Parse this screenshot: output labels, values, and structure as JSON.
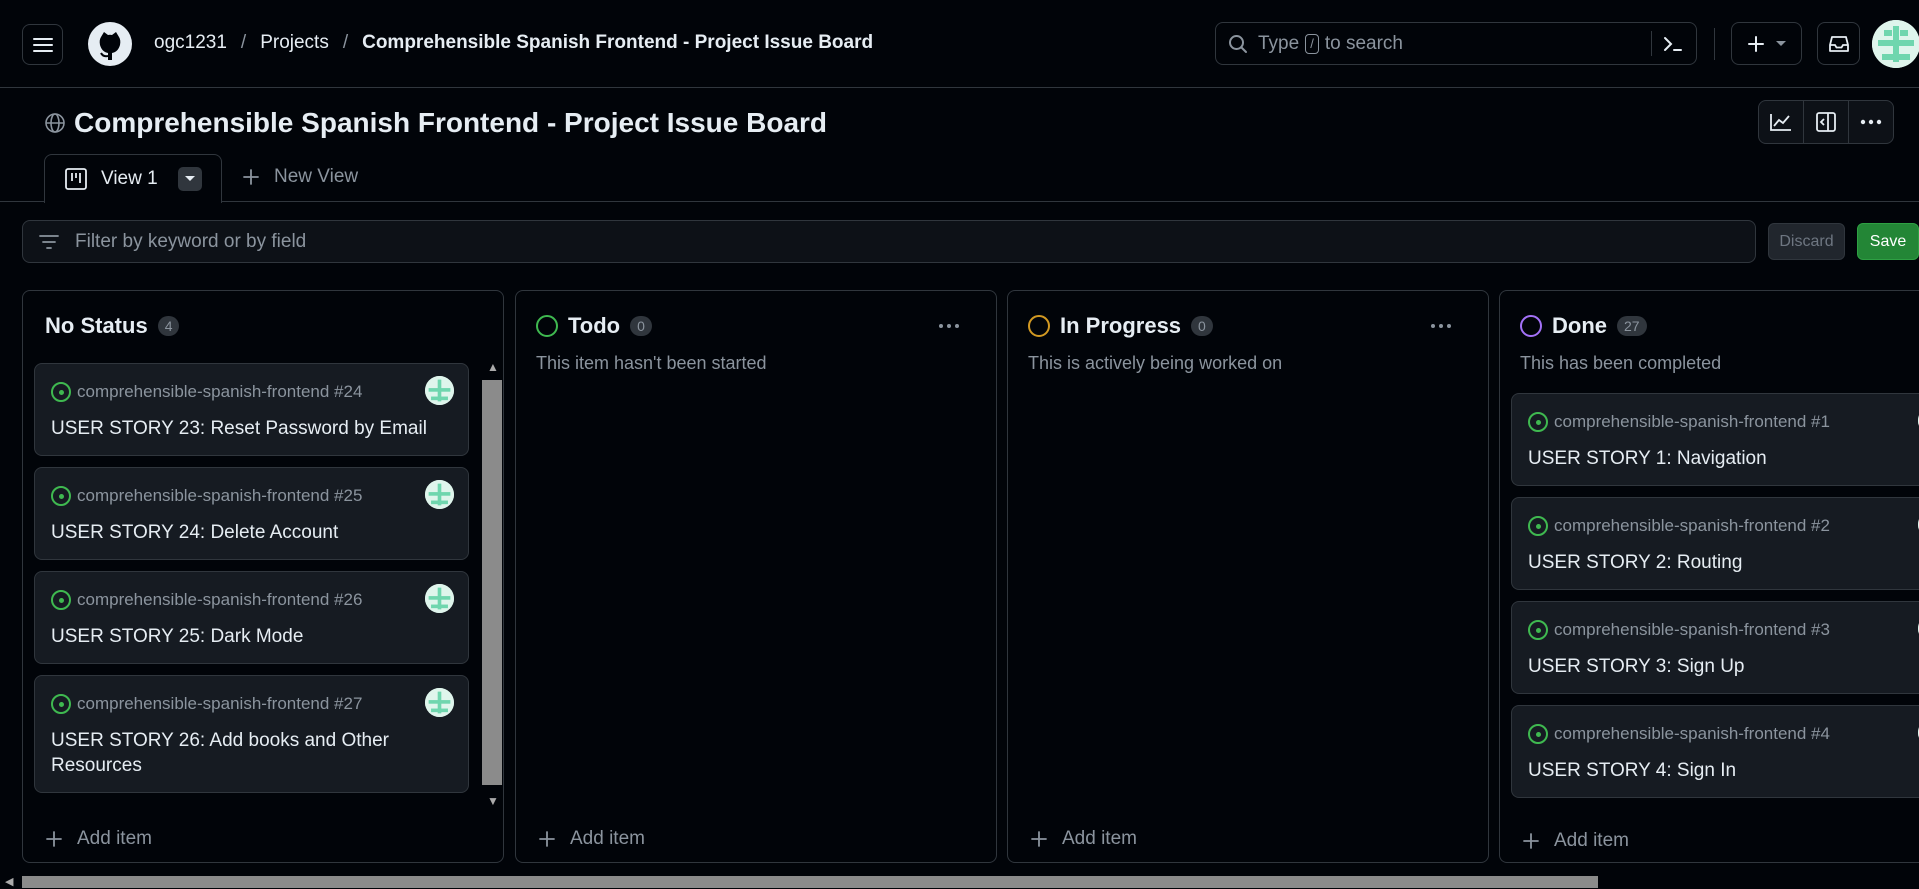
{
  "header": {
    "breadcrumbs": [
      "ogc1231",
      "Projects",
      "Comprehensible Spanish Frontend - Project Issue Board"
    ],
    "separator": "/",
    "search": {
      "prefix": "Type",
      "key": "/",
      "suffix": "to search"
    }
  },
  "project": {
    "title": "Comprehensible Spanish Frontend - Project Issue Board"
  },
  "tabs": {
    "active": "View 1",
    "new_view": "New View"
  },
  "filter": {
    "placeholder": "Filter by keyword or by field",
    "discard": "Discard",
    "save": "Save"
  },
  "colors": {
    "green": "#3fb950",
    "orange": "#d29922",
    "purple": "#a371f7",
    "save": "#238636"
  },
  "columns": [
    {
      "name": "No Status",
      "count": "4",
      "description": "",
      "add_item": "Add item",
      "cards": [
        {
          "repo": "comprehensible-spanish-frontend #24",
          "title": "USER STORY 23: Reset Password by Email"
        },
        {
          "repo": "comprehensible-spanish-frontend #25",
          "title": "USER STORY 24: Delete Account"
        },
        {
          "repo": "comprehensible-spanish-frontend #26",
          "title": "USER STORY 25: Dark Mode"
        },
        {
          "repo": "comprehensible-spanish-frontend #27",
          "title": "USER STORY 26: Add books and Other Resources"
        }
      ]
    },
    {
      "name": "Todo",
      "count": "0",
      "description": "This item hasn't been started",
      "add_item": "Add item",
      "cards": []
    },
    {
      "name": "In Progress",
      "count": "0",
      "description": "This is actively being worked on",
      "add_item": "Add item",
      "cards": []
    },
    {
      "name": "Done",
      "count": "27",
      "description": "This has been completed",
      "add_item": "Add item",
      "cards": [
        {
          "repo": "comprehensible-spanish-frontend #1",
          "title": "USER STORY 1: Navigation"
        },
        {
          "repo": "comprehensible-spanish-frontend #2",
          "title": "USER STORY 2: Routing"
        },
        {
          "repo": "comprehensible-spanish-frontend #3",
          "title": "USER STORY 3: Sign Up"
        },
        {
          "repo": "comprehensible-spanish-frontend #4",
          "title": "USER STORY 4: Sign In"
        }
      ]
    }
  ]
}
